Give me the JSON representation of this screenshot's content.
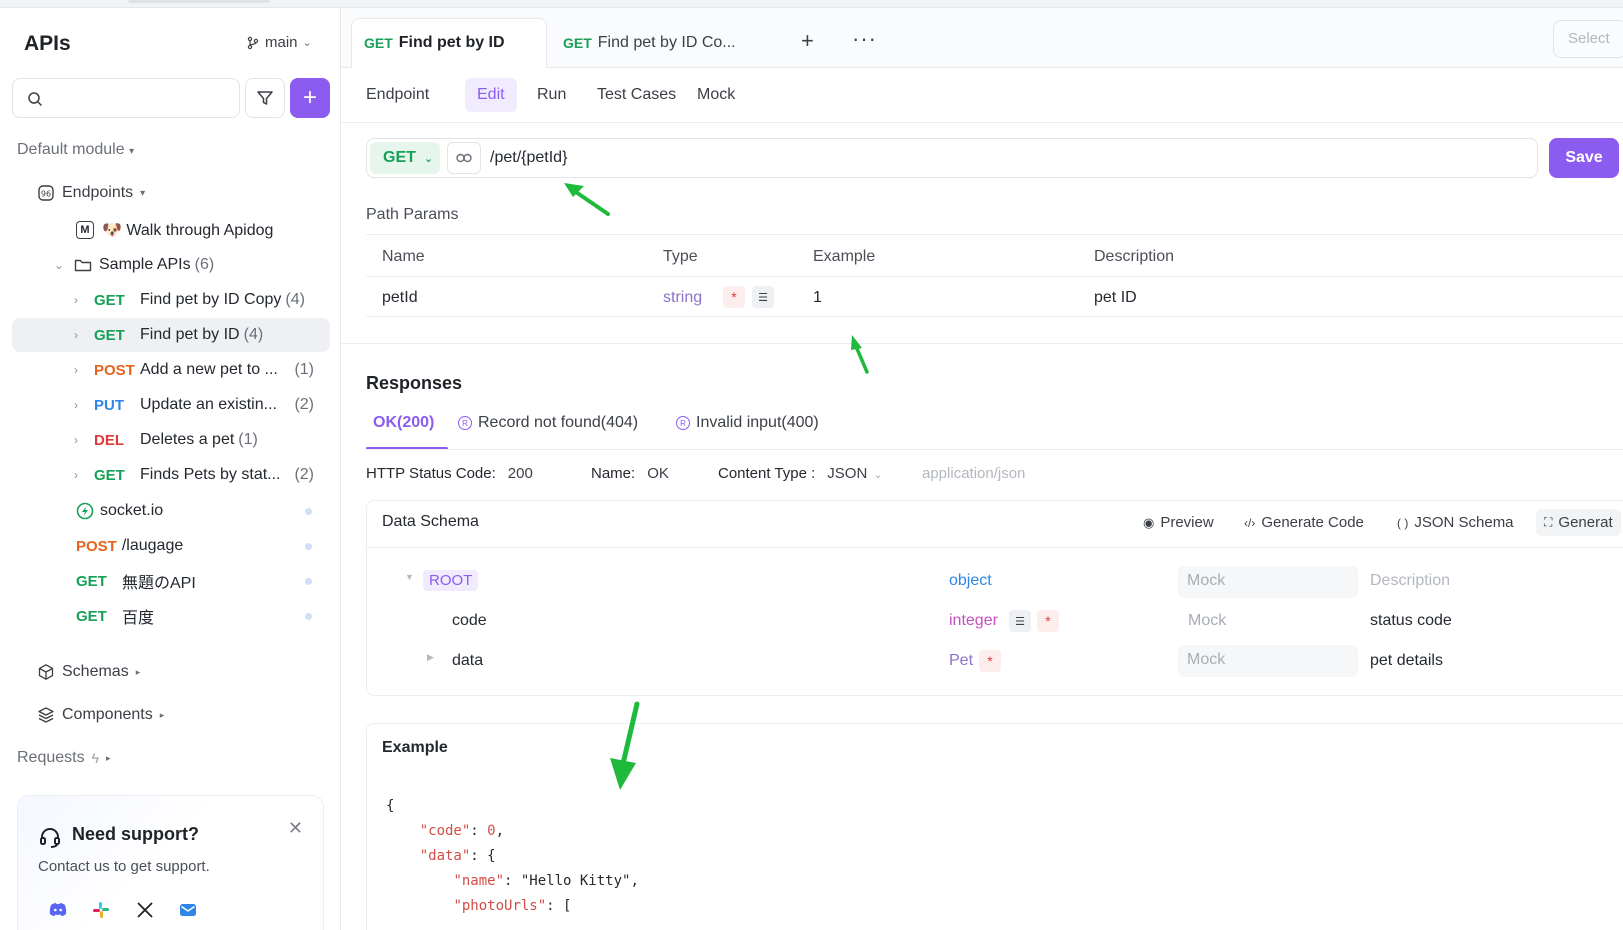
{
  "sidebar": {
    "title": "APIs",
    "branch": "main",
    "module": "Default module",
    "endpoints_label": "Endpoints",
    "items": [
      {
        "label": "🐶 Walk through Apidog"
      },
      {
        "label": "Sample APIs",
        "count": "(6)"
      },
      {
        "method": "GET",
        "label": "Find pet by ID Copy",
        "count": "(4)"
      },
      {
        "method": "GET",
        "label": "Find pet by ID",
        "count": "(4)"
      },
      {
        "method": "POST",
        "label": "Add a new pet to ...",
        "count": "(1)"
      },
      {
        "method": "PUT",
        "label": "Update an existin...",
        "count": "(2)"
      },
      {
        "method": "DEL",
        "label": "Deletes a pet",
        "count": "(1)"
      },
      {
        "method": "GET",
        "label": "Finds Pets by stat...",
        "count": "(2)"
      },
      {
        "label": "socket.io"
      },
      {
        "method": "POST",
        "label": "/laugage"
      },
      {
        "method": "GET",
        "label": "無題のAPI"
      },
      {
        "method": "GET",
        "label": "百度"
      }
    ],
    "schemas_label": "Schemas",
    "components_label": "Components",
    "requests_label": "Requests",
    "support": {
      "title": "Need support?",
      "subtitle": "Contact us to get support."
    }
  },
  "tabs": [
    {
      "method": "GET",
      "label": "Find pet by ID"
    },
    {
      "method": "GET",
      "label": "Find pet by ID Co..."
    }
  ],
  "select_placeholder": "Select",
  "subtabs": [
    "Endpoint",
    "Edit",
    "Run",
    "Test Cases",
    "Mock"
  ],
  "url": {
    "method": "GET",
    "path": "/pet/{petId}",
    "save_label": "Save"
  },
  "path_params": {
    "title": "Path Params",
    "headers": [
      "Name",
      "Type",
      "Example",
      "Description"
    ],
    "row": {
      "name": "petId",
      "type": "string",
      "example": "1",
      "description": "pet ID"
    }
  },
  "responses": {
    "title": "Responses",
    "tabs": [
      "OK(200)",
      "Record not found(404)",
      "Invalid input(400)"
    ],
    "status_label": "HTTP Status Code:",
    "status": "200",
    "name_label": "Name:",
    "name": "OK",
    "content_type_label": "Content Type :",
    "content_type": "JSON",
    "content_type_hint": "application/json"
  },
  "schema": {
    "title": "Data Schema",
    "actions": [
      "Preview",
      "Generate Code",
      "JSON Schema",
      "Generat"
    ],
    "rows": [
      {
        "name": "ROOT",
        "type": "object",
        "mock": "Mock",
        "description": "Description"
      },
      {
        "name": "code",
        "type": "integer",
        "mock": "Mock",
        "description": "status code"
      },
      {
        "name": "data",
        "type": "Pet",
        "mock": "Mock",
        "description": "pet details"
      }
    ]
  },
  "example": {
    "title": "Example",
    "lines": [
      "{",
      "    \"code\": 0,",
      "    \"data\": {",
      "        \"name\": \"Hello Kitty\",",
      "        \"photoUrls\": ["
    ]
  },
  "colors": {
    "accent": "#8c5cf0",
    "get": "#18a058",
    "post": "#e5631c",
    "put": "#2f86e6",
    "del": "#e03b3b",
    "arrow": "#1fba3c"
  }
}
